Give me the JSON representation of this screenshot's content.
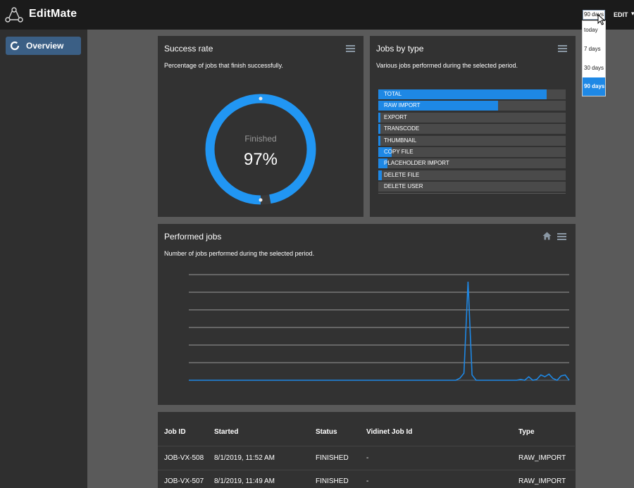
{
  "app": {
    "title": "EditMate"
  },
  "header": {
    "range_selected": "90 days",
    "range_options": [
      "today",
      "7 days",
      "30 days",
      "90 days"
    ],
    "edit_label": "EDIT",
    "caret": "▾"
  },
  "sidebar": {
    "items": [
      {
        "label": "Overview",
        "icon": "donut-icon"
      }
    ]
  },
  "success_card": {
    "title": "Success rate",
    "subtitle": "Percentage of jobs that finish successfully.",
    "center_label": "Finished",
    "center_value": "97%",
    "percent": 97,
    "ring_color": "#2196f3"
  },
  "types_card": {
    "title": "Jobs by type",
    "subtitle": "Various jobs performed during the selected period.",
    "bars": [
      {
        "label": "TOTAL",
        "fraction": 0.9
      },
      {
        "label": "RAW IMPORT",
        "fraction": 0.64
      },
      {
        "label": "EXPORT",
        "fraction": 0.012
      },
      {
        "label": "TRANSCODE",
        "fraction": 0.012
      },
      {
        "label": "THUMBNAIL",
        "fraction": 0.012
      },
      {
        "label": "COPY FILE",
        "fraction": 0.07
      },
      {
        "label": "PLACEHOLDER IMPORT",
        "fraction": 0.05
      },
      {
        "label": "DELETE FILE",
        "fraction": 0.02
      },
      {
        "label": "DELETE USER",
        "fraction": 0.0
      }
    ]
  },
  "performed_card": {
    "title": "Performed jobs",
    "subtitle": "Number of jobs performed during the selected period."
  },
  "chart_data": {
    "type": "line",
    "title": "Performed jobs",
    "subtitle": "Number of jobs performed during the selected period.",
    "grid": true,
    "ylim": [
      0,
      6
    ],
    "series": [
      {
        "color": "#1e88e5",
        "values": [
          0,
          0,
          0,
          0,
          0,
          0,
          0,
          0,
          0,
          0,
          0,
          0,
          0,
          0,
          0,
          0,
          0,
          0,
          0,
          0,
          0,
          0,
          0,
          0,
          0,
          0,
          0,
          0,
          0,
          0,
          0,
          0,
          0,
          0,
          0,
          0,
          0,
          0,
          0,
          0,
          0,
          0,
          0,
          0,
          0,
          0,
          0,
          0,
          0,
          0,
          0,
          0,
          0,
          0,
          0,
          0,
          0,
          0,
          0,
          0,
          0,
          0,
          0,
          0,
          0,
          0,
          0,
          0.12,
          0.4,
          5.6,
          0.3,
          0,
          0,
          0,
          0,
          0,
          0,
          0,
          0,
          0,
          0,
          0,
          0.05,
          0,
          0.2,
          0,
          0.05,
          0.3,
          0.2,
          0.35,
          0.1,
          0,
          0.25,
          0.3,
          0
        ]
      }
    ]
  },
  "jobs_table": {
    "columns": [
      "Job ID",
      "Started",
      "Status",
      "Vidinet Job Id",
      "Type"
    ],
    "rows": [
      [
        "JOB-VX-508",
        "8/1/2019, 11:52 AM",
        "FINISHED",
        "-",
        "RAW_IMPORT"
      ],
      [
        "JOB-VX-507",
        "8/1/2019, 11:49 AM",
        "FINISHED",
        "-",
        "RAW_IMPORT"
      ]
    ]
  }
}
